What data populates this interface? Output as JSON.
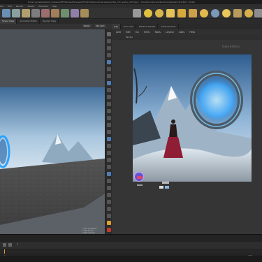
{
  "window": {
    "title": "D:\\terry\\materials\\art_material\\PFX\\Nomad\\Scenes\\VFX\\Portal\\houdini\\scenes\\portal_v21_alpha_v03.hipnc - Houdini Indie Limited-Commercial 20.0.625 - Portal"
  },
  "menubar": {
    "items": [
      "File",
      "Edit",
      "Render",
      "Assets",
      "Windows",
      "Help"
    ]
  },
  "shelf": {
    "left_tools": [
      "Create",
      "Modify",
      "Model",
      "Polygon",
      "Deform",
      "Texture",
      "Rigging",
      "Characters",
      "Constraints"
    ],
    "right_tools": [
      "Lights and Cameras",
      "Collisions",
      "Particles",
      "Grains",
      "Vellum",
      "Rigid Bodies",
      "Particle Fluids",
      "Viscous Fluids",
      "Oceans",
      "Pyro FX"
    ],
    "right_icons": [
      "Camera",
      "Point Light",
      "Spot Light",
      "Area Light",
      "Geometry Light",
      "Volume Light",
      "Distant Light",
      "Environment Light",
      "Sky Light",
      "Portal Light",
      "Ambient Light",
      "Stereo Camera"
    ]
  },
  "left_tabs": [
    "Scene View",
    "Animation Editor",
    "Render View",
    "Composite View",
    "Motion FX View"
  ],
  "right_tabs": [
    "/obj",
    "Tree View",
    "Material Palette",
    "Asset Browser"
  ],
  "right_menu": [
    "Add",
    "Edit",
    "Go",
    "View",
    "Tools",
    "Layout",
    "Labs",
    "Help"
  ],
  "viewport": {
    "persp_label": "Persp",
    "cam_label": "No cam",
    "hud_lines": [
      "1,024  primitives",
      "1,089  points",
      "4,096  vertices"
    ]
  },
  "right_panel": {
    "context": "Indie Edition",
    "path": "Terrain"
  },
  "timeline": {
    "frame": "1",
    "start": "1",
    "end": "240"
  },
  "colors": {
    "accent": "#e0a030",
    "panel_bg": "#353535",
    "viewport_bg": "#4a4f55"
  }
}
